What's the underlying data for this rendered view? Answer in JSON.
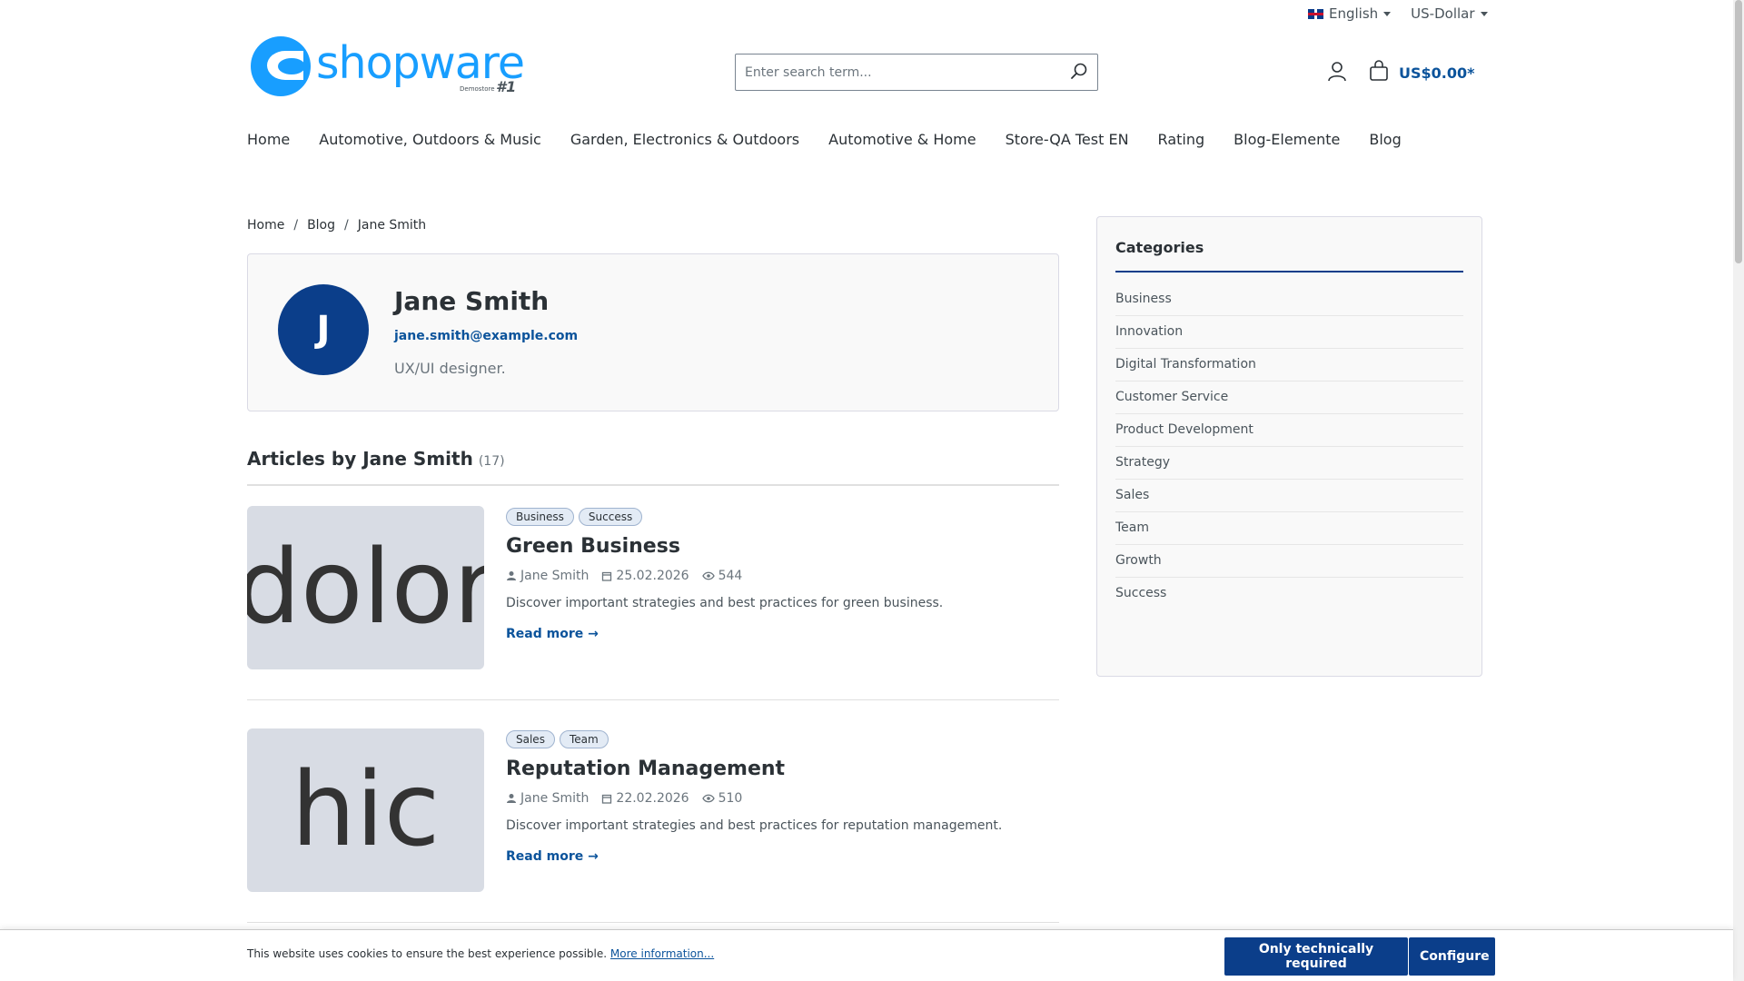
{
  "topbar": {
    "language": "English",
    "currency": "US-Dollar",
    "language_icon": "uk-flag-icon"
  },
  "header": {
    "logo_text": "shopware",
    "logo_sub": "Demostore",
    "logo_num": "#1",
    "search_placeholder": "Enter search term...",
    "cart_total": "US$0.00*"
  },
  "nav": {
    "items": [
      {
        "label": "Home"
      },
      {
        "label": "Automotive, Outdoors & Music"
      },
      {
        "label": "Garden, Electronics & Outdoors"
      },
      {
        "label": "Automotive & Home"
      },
      {
        "label": "Store-QA Test EN"
      },
      {
        "label": "Rating"
      },
      {
        "label": "Blog-Elemente"
      },
      {
        "label": "Blog"
      }
    ]
  },
  "breadcrumb": {
    "items": [
      "Home",
      "Blog",
      "Jane Smith"
    ],
    "separator": "/"
  },
  "author": {
    "initial": "J",
    "name": "Jane Smith",
    "email": "jane.smith@example.com",
    "bio": "UX/UI designer."
  },
  "articles": {
    "title": "Articles by Jane Smith",
    "count": "(17)",
    "items": [
      {
        "thumb_text": "dolor",
        "tags": [
          "Business",
          "Success"
        ],
        "title": "Green Business",
        "author": "Jane Smith",
        "date": "25.02.2026",
        "views": "544",
        "excerpt": "Discover important strategies and best practices for green business.",
        "read_more": "Read more →"
      },
      {
        "thumb_text": "hic",
        "tags": [
          "Sales",
          "Team"
        ],
        "title": "Reputation Management",
        "author": "Jane Smith",
        "date": "22.02.2026",
        "views": "510",
        "excerpt": "Discover important strategies and best practices for reputation management.",
        "read_more": "Read more →"
      }
    ]
  },
  "sidebar": {
    "title": "Categories",
    "categories": [
      "Business",
      "Innovation",
      "Digital Transformation",
      "Customer Service",
      "Product Development",
      "Strategy",
      "Sales",
      "Team",
      "Growth",
      "Success"
    ]
  },
  "cookie": {
    "text": "This website uses cookies to ensure the best experience possible.",
    "link": "More information...",
    "btn_required": "Only technically required",
    "btn_configure": "Configure"
  },
  "colors": {
    "brand": "#189eff",
    "primary": "#0b3e8a",
    "link": "#0b539b"
  }
}
